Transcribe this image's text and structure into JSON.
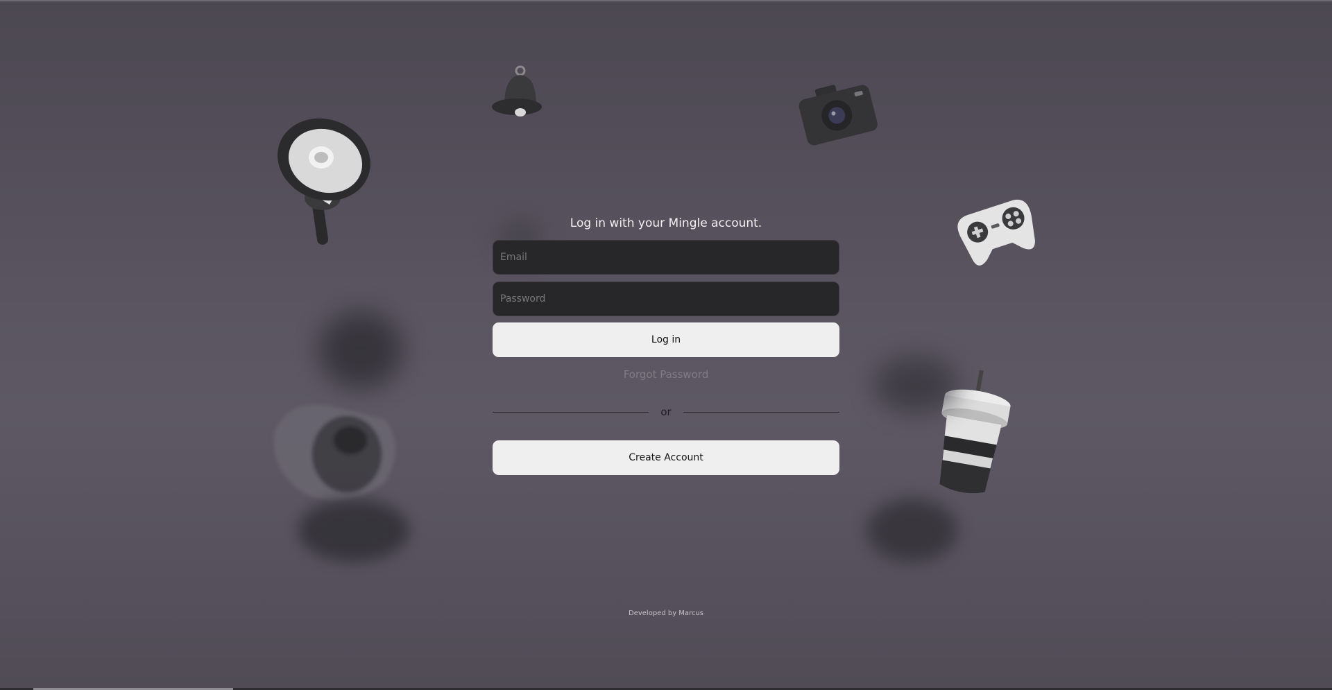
{
  "login": {
    "title": "Log in with your Mingle account.",
    "email_placeholder": "Email",
    "password_placeholder": "Password",
    "login_label": "Log in",
    "forgot_label": "Forgot Password",
    "or_label": "or",
    "create_label": "Create Account"
  },
  "footer": {
    "text": "Developed by Marcus"
  },
  "decorations": [
    "megaphone-icon",
    "bell-icon",
    "camera-icon",
    "gamepad-icon",
    "coffee-cup-icon",
    "blurred-object"
  ],
  "colors": {
    "background": "#58535e",
    "input_bg": "#272628",
    "button_bg": "#efefef",
    "forgot_text": "#807c86"
  }
}
